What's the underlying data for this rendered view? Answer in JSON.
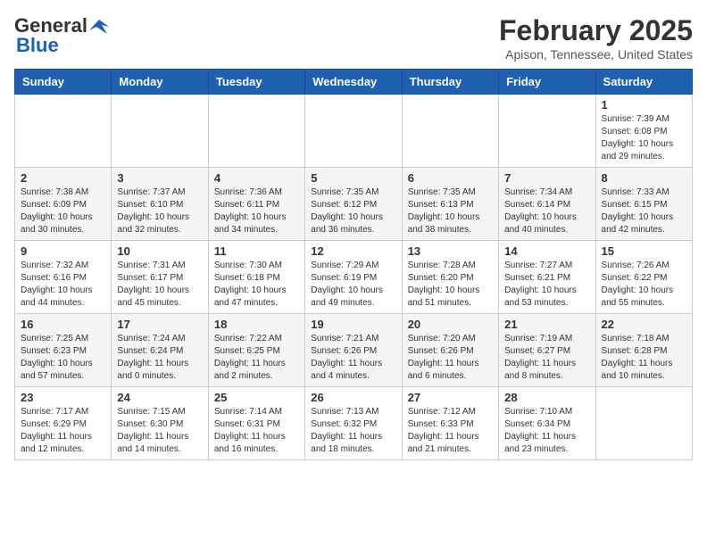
{
  "header": {
    "logo_general": "General",
    "logo_blue": "Blue",
    "month": "February 2025",
    "location": "Apison, Tennessee, United States"
  },
  "weekdays": [
    "Sunday",
    "Monday",
    "Tuesday",
    "Wednesday",
    "Thursday",
    "Friday",
    "Saturday"
  ],
  "weeks": [
    [
      {
        "day": "",
        "info": ""
      },
      {
        "day": "",
        "info": ""
      },
      {
        "day": "",
        "info": ""
      },
      {
        "day": "",
        "info": ""
      },
      {
        "day": "",
        "info": ""
      },
      {
        "day": "",
        "info": ""
      },
      {
        "day": "1",
        "info": "Sunrise: 7:39 AM\nSunset: 6:08 PM\nDaylight: 10 hours\nand 29 minutes."
      }
    ],
    [
      {
        "day": "2",
        "info": "Sunrise: 7:38 AM\nSunset: 6:09 PM\nDaylight: 10 hours\nand 30 minutes."
      },
      {
        "day": "3",
        "info": "Sunrise: 7:37 AM\nSunset: 6:10 PM\nDaylight: 10 hours\nand 32 minutes."
      },
      {
        "day": "4",
        "info": "Sunrise: 7:36 AM\nSunset: 6:11 PM\nDaylight: 10 hours\nand 34 minutes."
      },
      {
        "day": "5",
        "info": "Sunrise: 7:35 AM\nSunset: 6:12 PM\nDaylight: 10 hours\nand 36 minutes."
      },
      {
        "day": "6",
        "info": "Sunrise: 7:35 AM\nSunset: 6:13 PM\nDaylight: 10 hours\nand 38 minutes."
      },
      {
        "day": "7",
        "info": "Sunrise: 7:34 AM\nSunset: 6:14 PM\nDaylight: 10 hours\nand 40 minutes."
      },
      {
        "day": "8",
        "info": "Sunrise: 7:33 AM\nSunset: 6:15 PM\nDaylight: 10 hours\nand 42 minutes."
      }
    ],
    [
      {
        "day": "9",
        "info": "Sunrise: 7:32 AM\nSunset: 6:16 PM\nDaylight: 10 hours\nand 44 minutes."
      },
      {
        "day": "10",
        "info": "Sunrise: 7:31 AM\nSunset: 6:17 PM\nDaylight: 10 hours\nand 45 minutes."
      },
      {
        "day": "11",
        "info": "Sunrise: 7:30 AM\nSunset: 6:18 PM\nDaylight: 10 hours\nand 47 minutes."
      },
      {
        "day": "12",
        "info": "Sunrise: 7:29 AM\nSunset: 6:19 PM\nDaylight: 10 hours\nand 49 minutes."
      },
      {
        "day": "13",
        "info": "Sunrise: 7:28 AM\nSunset: 6:20 PM\nDaylight: 10 hours\nand 51 minutes."
      },
      {
        "day": "14",
        "info": "Sunrise: 7:27 AM\nSunset: 6:21 PM\nDaylight: 10 hours\nand 53 minutes."
      },
      {
        "day": "15",
        "info": "Sunrise: 7:26 AM\nSunset: 6:22 PM\nDaylight: 10 hours\nand 55 minutes."
      }
    ],
    [
      {
        "day": "16",
        "info": "Sunrise: 7:25 AM\nSunset: 6:23 PM\nDaylight: 10 hours\nand 57 minutes."
      },
      {
        "day": "17",
        "info": "Sunrise: 7:24 AM\nSunset: 6:24 PM\nDaylight: 11 hours\nand 0 minutes."
      },
      {
        "day": "18",
        "info": "Sunrise: 7:22 AM\nSunset: 6:25 PM\nDaylight: 11 hours\nand 2 minutes."
      },
      {
        "day": "19",
        "info": "Sunrise: 7:21 AM\nSunset: 6:26 PM\nDaylight: 11 hours\nand 4 minutes."
      },
      {
        "day": "20",
        "info": "Sunrise: 7:20 AM\nSunset: 6:26 PM\nDaylight: 11 hours\nand 6 minutes."
      },
      {
        "day": "21",
        "info": "Sunrise: 7:19 AM\nSunset: 6:27 PM\nDaylight: 11 hours\nand 8 minutes."
      },
      {
        "day": "22",
        "info": "Sunrise: 7:18 AM\nSunset: 6:28 PM\nDaylight: 11 hours\nand 10 minutes."
      }
    ],
    [
      {
        "day": "23",
        "info": "Sunrise: 7:17 AM\nSunset: 6:29 PM\nDaylight: 11 hours\nand 12 minutes."
      },
      {
        "day": "24",
        "info": "Sunrise: 7:15 AM\nSunset: 6:30 PM\nDaylight: 11 hours\nand 14 minutes."
      },
      {
        "day": "25",
        "info": "Sunrise: 7:14 AM\nSunset: 6:31 PM\nDaylight: 11 hours\nand 16 minutes."
      },
      {
        "day": "26",
        "info": "Sunrise: 7:13 AM\nSunset: 6:32 PM\nDaylight: 11 hours\nand 18 minutes."
      },
      {
        "day": "27",
        "info": "Sunrise: 7:12 AM\nSunset: 6:33 PM\nDaylight: 11 hours\nand 21 minutes."
      },
      {
        "day": "28",
        "info": "Sunrise: 7:10 AM\nSunset: 6:34 PM\nDaylight: 11 hours\nand 23 minutes."
      },
      {
        "day": "",
        "info": ""
      }
    ]
  ]
}
